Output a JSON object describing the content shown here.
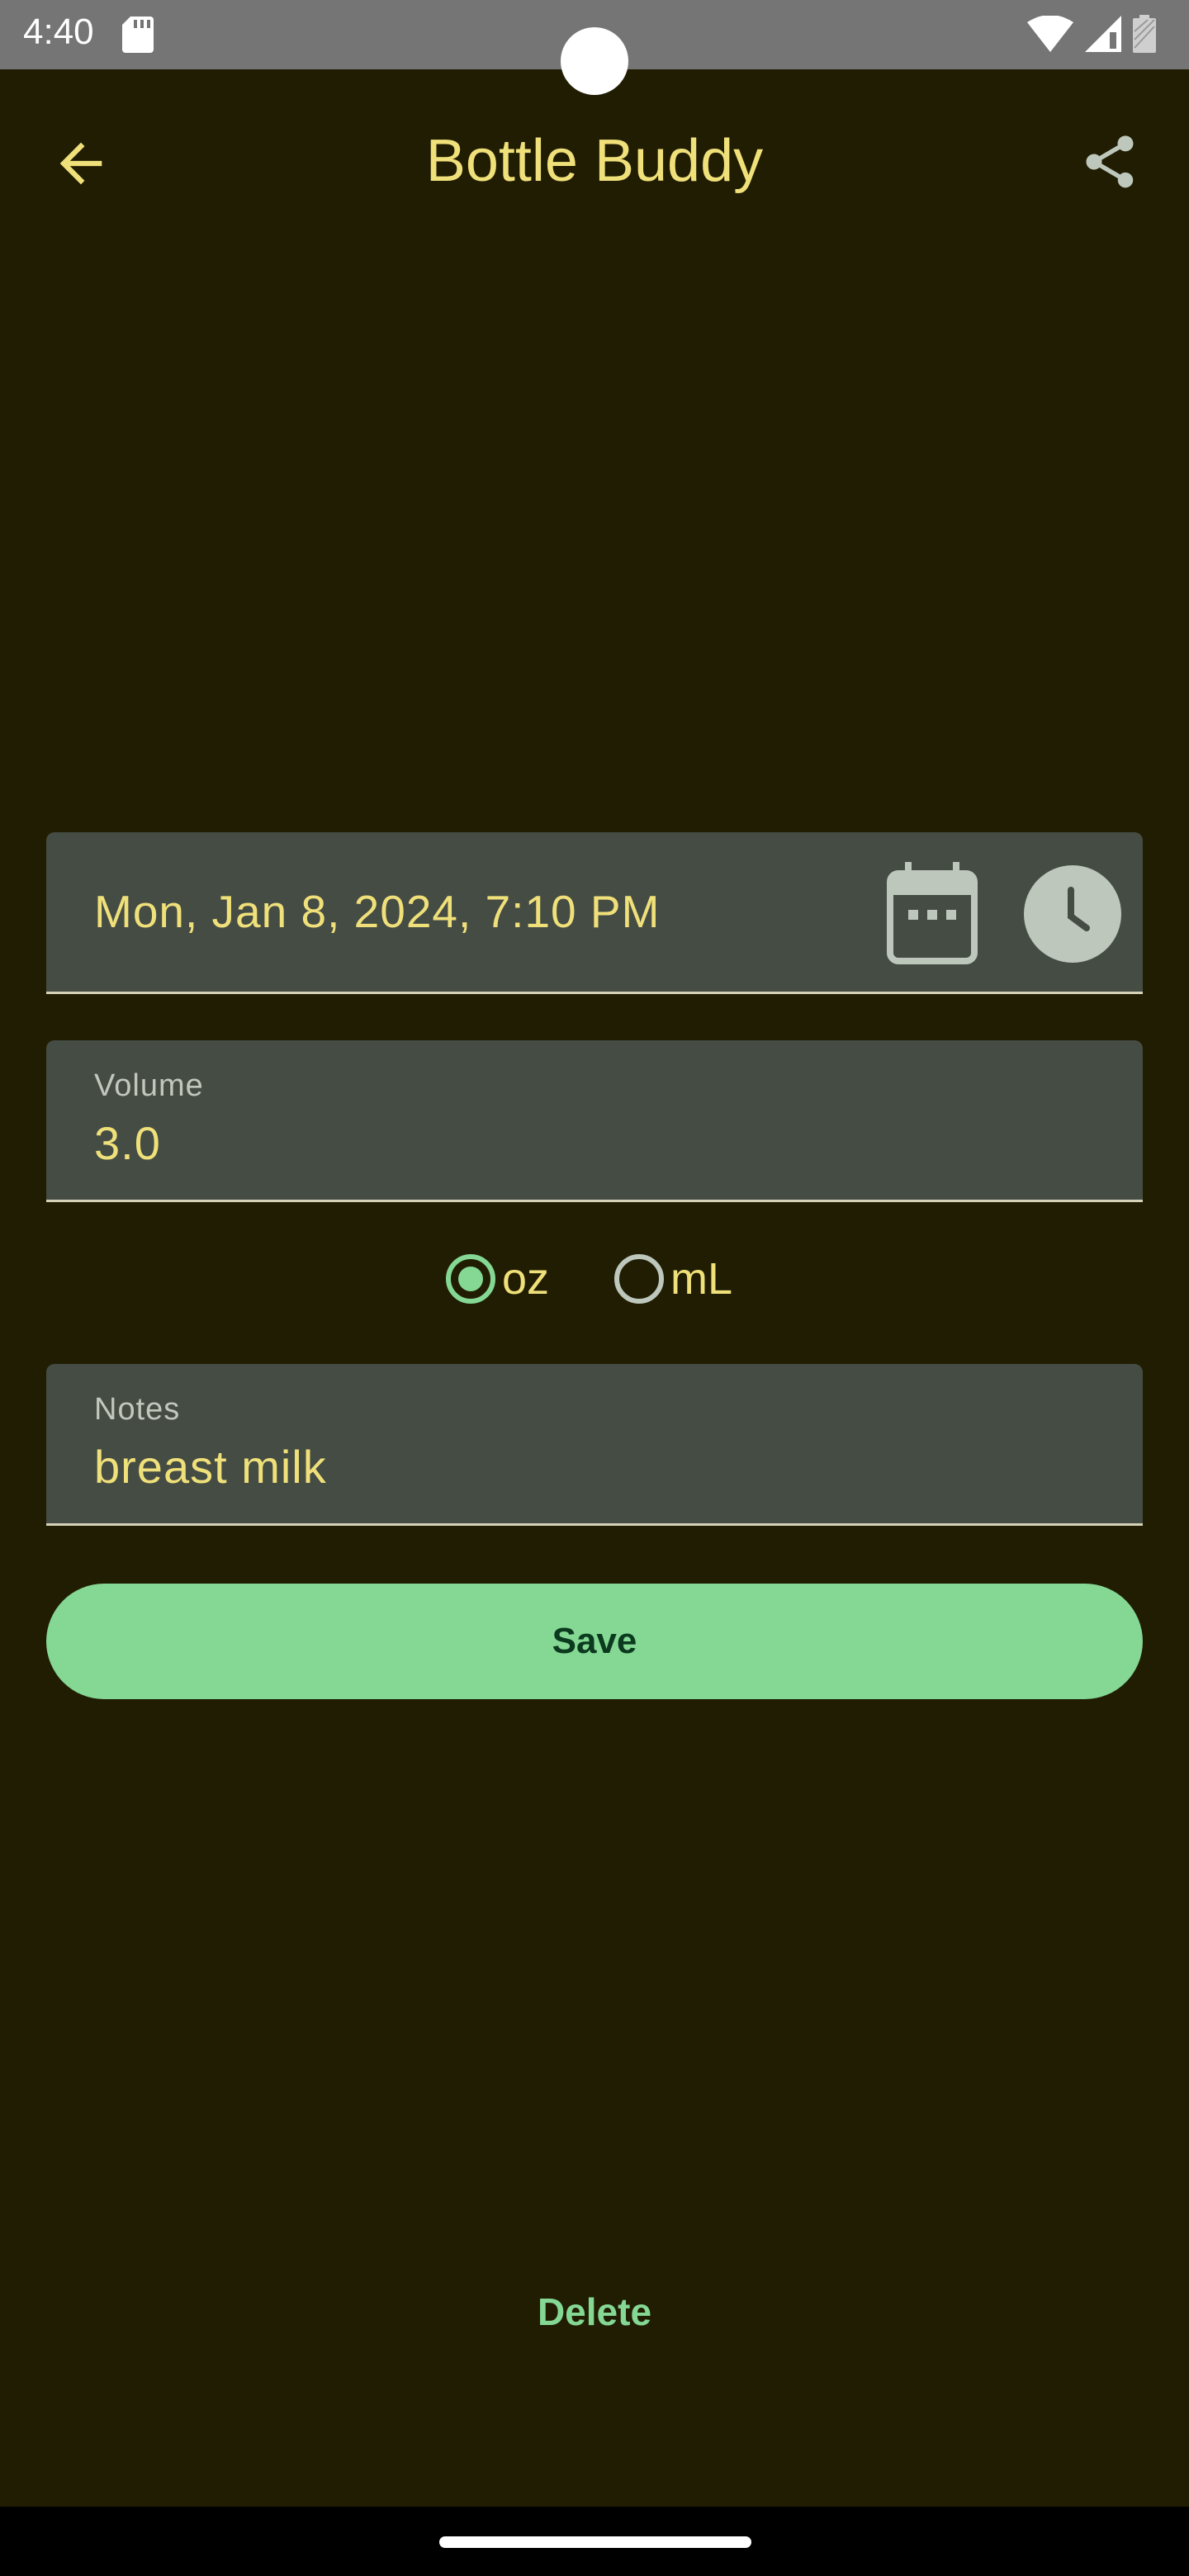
{
  "status_bar": {
    "time": "4:40",
    "icons": [
      "sd-card-icon",
      "wifi-icon",
      "signal-icon",
      "battery-icon"
    ]
  },
  "app_bar": {
    "title": "Bottle Buddy",
    "back_icon": "arrow-back-icon",
    "share_icon": "share-icon"
  },
  "datetime": {
    "value": "Mon, Jan 8, 2024, 7:10 PM",
    "calendar_icon": "calendar-icon",
    "clock_icon": "clock-icon"
  },
  "volume": {
    "label": "Volume",
    "value": "3.0"
  },
  "units": {
    "options": [
      {
        "label": "oz",
        "selected": true
      },
      {
        "label": "mL",
        "selected": false
      }
    ]
  },
  "notes": {
    "label": "Notes",
    "value": "breast milk"
  },
  "actions": {
    "save_label": "Save",
    "delete_label": "Delete"
  },
  "colors": {
    "background": "#201d02",
    "accent": "#84d894",
    "title_text": "#f0e07a",
    "field_bg": "#444c44"
  }
}
